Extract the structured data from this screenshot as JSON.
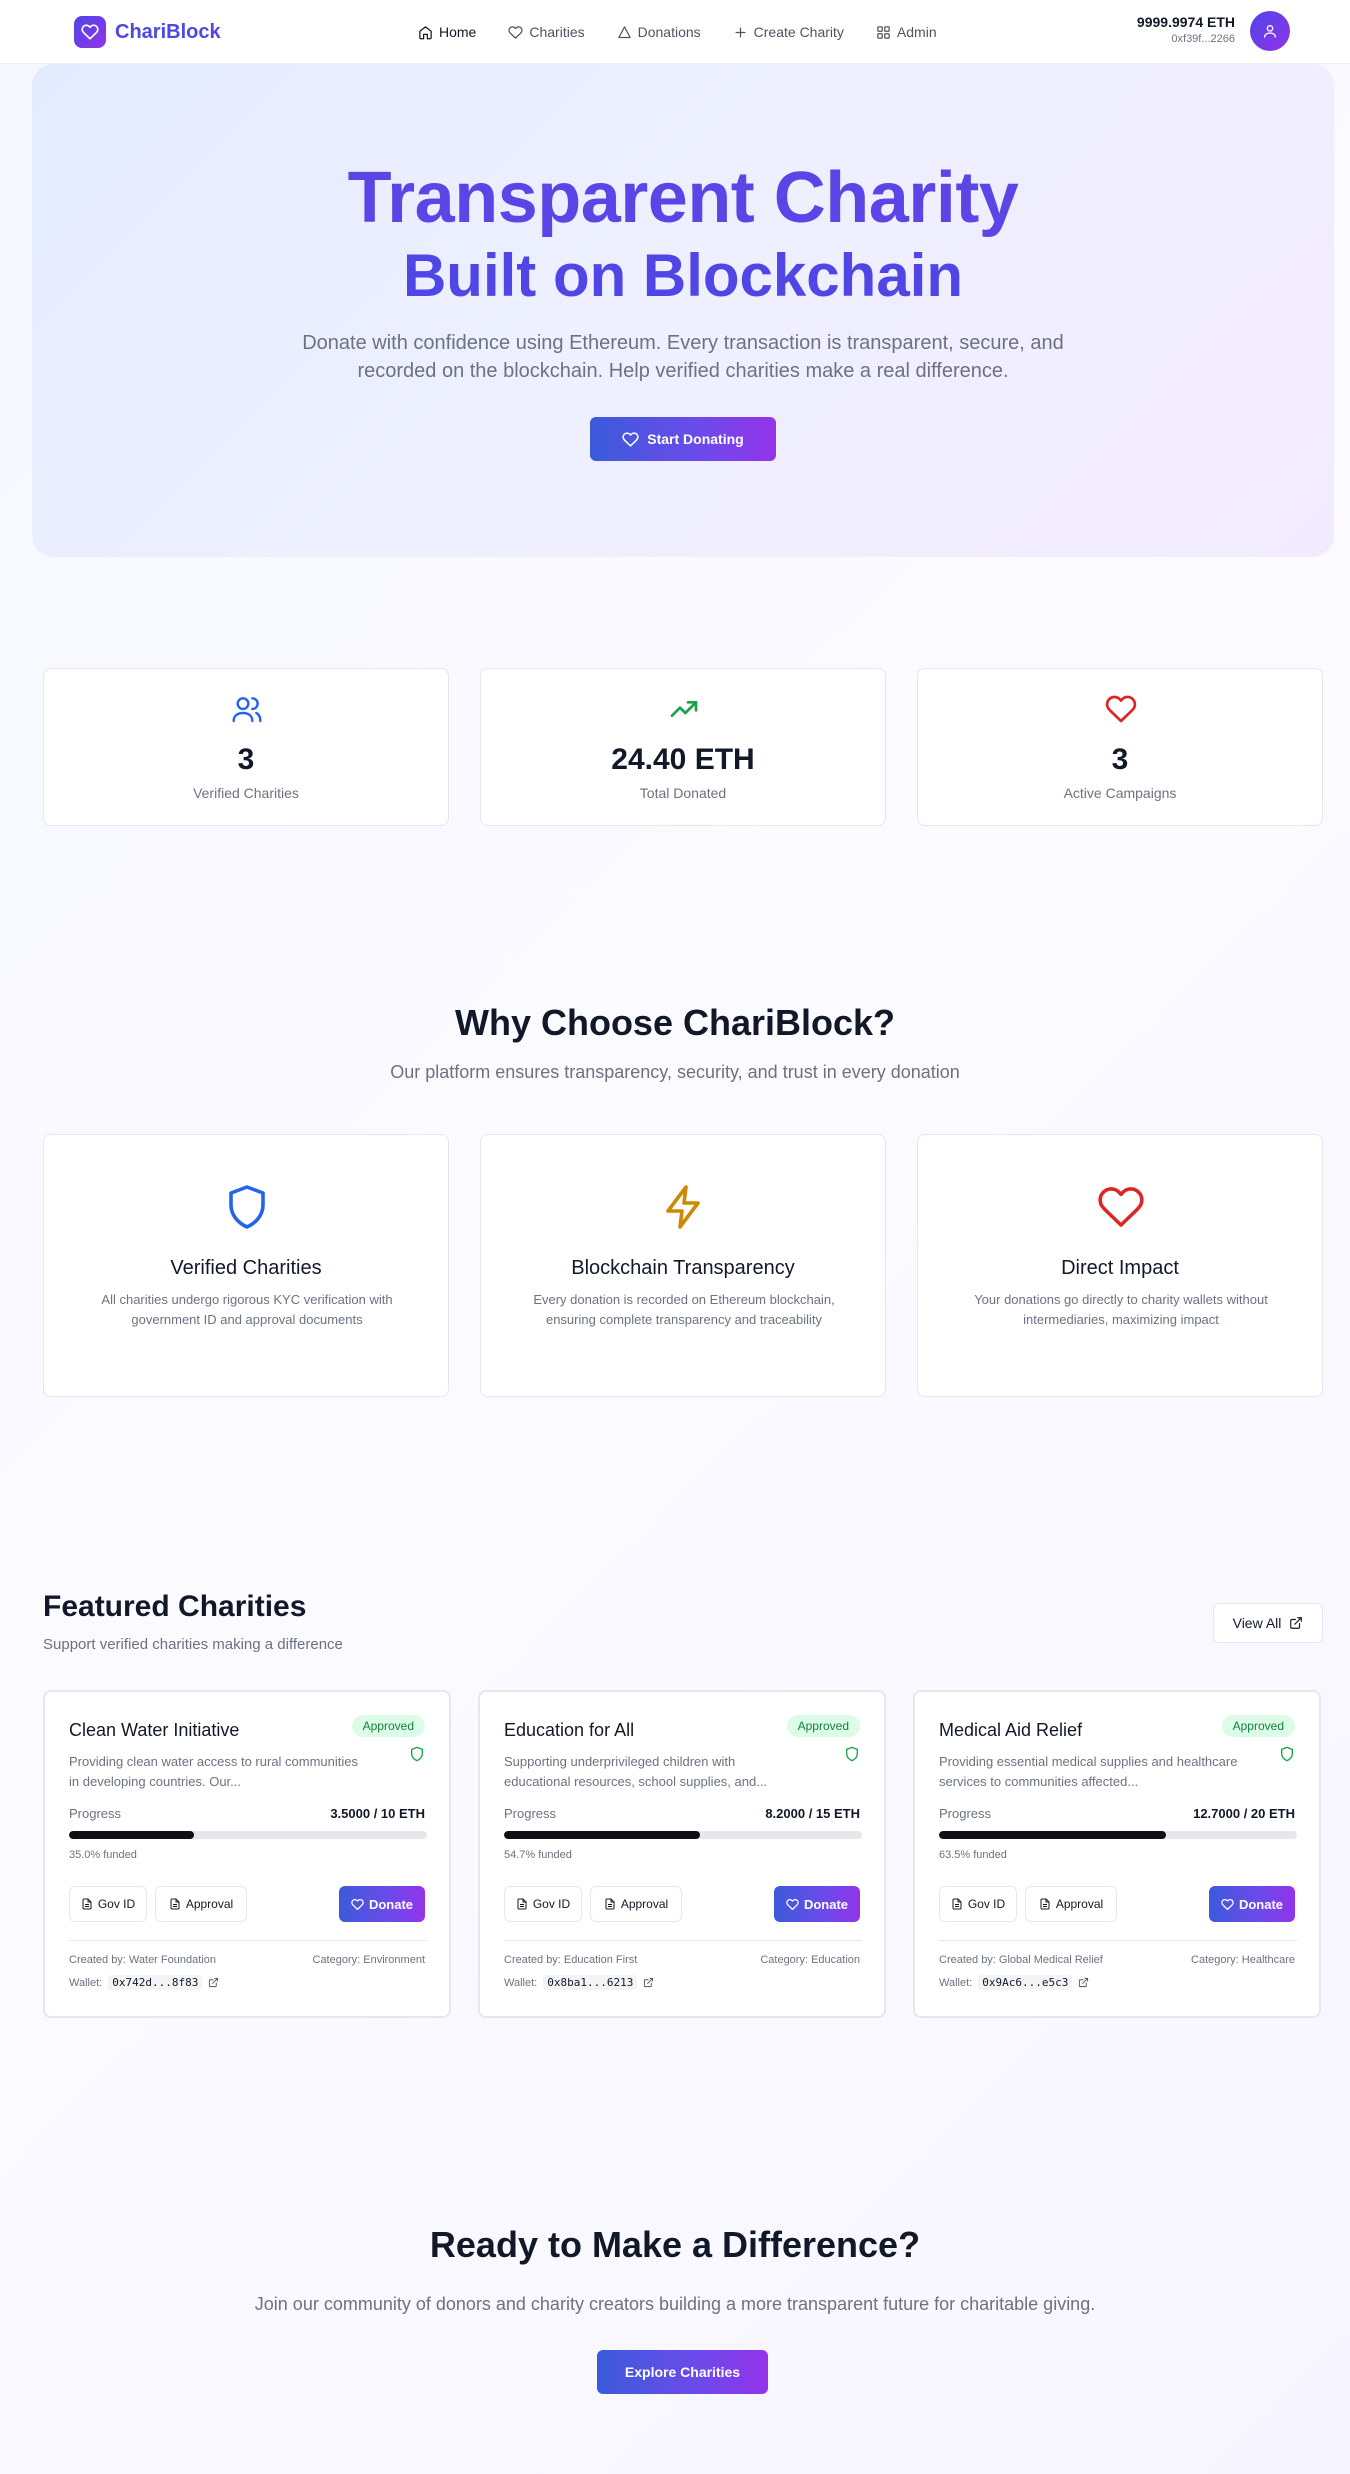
{
  "nav": {
    "brand": "ChariBlock",
    "links": [
      {
        "label": "Home",
        "icon": "home-icon",
        "active": true
      },
      {
        "label": "Charities",
        "icon": "heart-icon"
      },
      {
        "label": "Donations",
        "icon": "triangle-icon"
      },
      {
        "label": "Create Charity",
        "icon": "plus-icon"
      },
      {
        "label": "Admin",
        "icon": "grid-icon"
      }
    ],
    "wallet_balance": "9999.9974 ETH",
    "wallet_address": "0xf39f...2266"
  },
  "hero": {
    "title_line1": "Transparent Charity",
    "title_line2": "Built on Blockchain",
    "subtitle": "Donate with confidence using Ethereum. Every transaction is transparent, secure, and recorded on the blockchain. Help verified charities make a real difference.",
    "cta": "Start Donating"
  },
  "stats": [
    {
      "value": "3",
      "label": "Verified Charities",
      "icon": "users-icon",
      "color": "#2563eb"
    },
    {
      "value": "24.40 ETH",
      "label": "Total Donated",
      "icon": "trending-up-icon",
      "color": "#16a34a"
    },
    {
      "value": "3",
      "label": "Active Campaigns",
      "icon": "heart-icon",
      "color": "#dc2626"
    }
  ],
  "why": {
    "title": "Why Choose ChariBlock?",
    "subtitle": "Our platform ensures transparency, security, and trust in every donation",
    "features": [
      {
        "title": "Verified Charities",
        "desc": "All charities undergo rigorous KYC verification with government ID and approval documents",
        "icon": "shield-icon",
        "color": "#2563eb"
      },
      {
        "title": "Blockchain Transparency",
        "desc": "Every donation is recorded on Ethereum blockchain, ensuring complete transparency and traceability",
        "icon": "lightning-icon",
        "color": "#ca8a04"
      },
      {
        "title": "Direct Impact",
        "desc": "Your donations go directly to charity wallets without intermediaries, maximizing impact",
        "icon": "heart-icon",
        "color": "#dc2626"
      }
    ]
  },
  "featured": {
    "title": "Featured Charities",
    "subtitle": "Support verified charities making a difference",
    "view_all": "View All",
    "cards": [
      {
        "title": "Clean Water Initiative",
        "status": "Approved",
        "desc": "Providing clean water access to rural communities in developing countries. Our...",
        "progress_label": "Progress",
        "progress_value": "3.5000 / 10 ETH",
        "progress_fraction": 0.35,
        "funded": "35.0% funded",
        "gov_id": "Gov ID",
        "approval": "Approval",
        "donate": "Donate",
        "creator": "Created by: Water Foundation",
        "category": "Category: Environment",
        "wallet_label": "Wallet:",
        "wallet": "0x742d...8f83"
      },
      {
        "title": "Education for All",
        "status": "Approved",
        "desc": "Supporting underprivileged children with educational resources, school supplies, and...",
        "progress_label": "Progress",
        "progress_value": "8.2000 / 15 ETH",
        "progress_fraction": 0.547,
        "funded": "54.7% funded",
        "gov_id": "Gov ID",
        "approval": "Approval",
        "donate": "Donate",
        "creator": "Created by: Education First",
        "category": "Category: Education",
        "wallet_label": "Wallet:",
        "wallet": "0x8ba1...6213"
      },
      {
        "title": "Medical Aid Relief",
        "status": "Approved",
        "desc": "Providing essential medical supplies and healthcare services to communities affected...",
        "progress_label": "Progress",
        "progress_value": "12.7000 / 20 ETH",
        "progress_fraction": 0.635,
        "funded": "63.5% funded",
        "gov_id": "Gov ID",
        "approval": "Approval",
        "donate": "Donate",
        "creator": "Created by: Global Medical Relief",
        "category": "Category: Healthcare",
        "wallet_label": "Wallet:",
        "wallet": "0x9Ac6...e5c3"
      }
    ]
  },
  "cta": {
    "title": "Ready to Make a Difference?",
    "subtitle": "Join our community of donors and charity creators building a more transparent future for charitable giving.",
    "button": "Explore Charities"
  },
  "colors": {
    "brand": "#4f46e5",
    "brand_end": "#9333ea",
    "approved_bg": "#dcfce7",
    "approved_text": "#15803d"
  }
}
